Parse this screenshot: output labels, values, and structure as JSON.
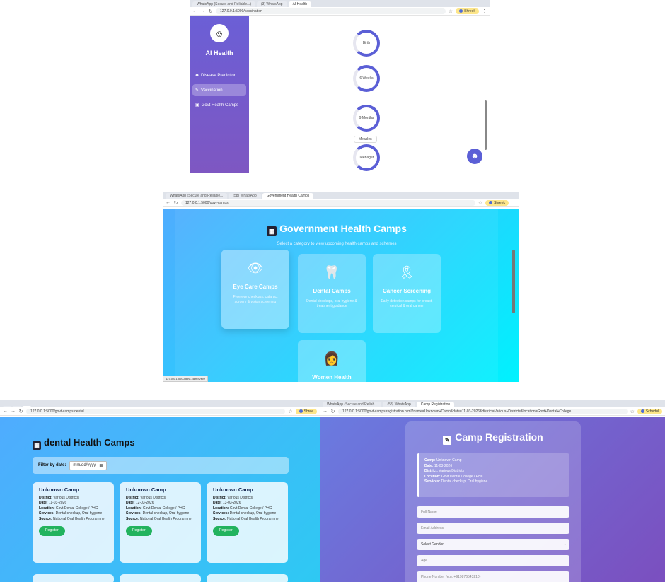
{
  "panel1": {
    "tabs": [
      "WhatsApp (Secure and Reliable...)",
      "(3) WhatsApp",
      "AI Health"
    ],
    "url": "127.0.0.1:5000/vaccination",
    "profile": "Shreek",
    "sidebar": {
      "title": "AI Health",
      "items": [
        {
          "label": "Disease Prediction",
          "icon": "virus-icon"
        },
        {
          "label": "Vaccination",
          "icon": "syringe-icon",
          "active": true
        },
        {
          "label": "Govt Health Camps",
          "icon": "building-icon"
        }
      ]
    },
    "timeline": [
      "Birth",
      "6 Weeks",
      "9 Months",
      "Teenager"
    ],
    "tooltip": "Measles"
  },
  "panel2": {
    "tabs": [
      "WhatsApp (Secure and Reliable...",
      "(58) WhatsApp",
      "Government Health Camps"
    ],
    "url": "127.0.0.1:5000/govt-camps",
    "profile": "Shreek",
    "title": "Government Health Camps",
    "subtitle": "Select a category to view upcoming health camps and schemes",
    "cards": [
      {
        "title": "Eye Care Camps",
        "desc": "Free eye checkups, cataract surgery & vision screening",
        "icon": "eye-icon"
      },
      {
        "title": "Dental Camps",
        "desc": "Dental checkups, oral hygiene & treatment guidance",
        "icon": "tooth-icon"
      },
      {
        "title": "Cancer Screening",
        "desc": "Early detection camps for breast, cervical & oral cancer",
        "icon": "ribbon-icon"
      },
      {
        "title": "Women Health",
        "desc": "",
        "icon": "woman-doctor-icon"
      }
    ],
    "status_url": "127.0.0.1:5000/govt-camps/eye"
  },
  "panel3": {
    "url": "127.0.0.1:5000/govt-camps/dental",
    "profile": "Shree",
    "title": "dental Health Camps",
    "filter_label": "Filter by date:",
    "date_placeholder": "mm/dd/yyyy",
    "camps": [
      {
        "name": "Unknown Camp",
        "district": "Various Districts",
        "date": "11-03-2026",
        "location": "Govt Dental College / PHC",
        "services": "Dental checkup, Oral hygiene",
        "source": "National Oral Health Programme",
        "button": "Register"
      },
      {
        "name": "Unknown Camp",
        "district": "Various Districts",
        "date": "12-03-2026",
        "location": "Govt Dental College / PHC",
        "services": "Dental checkup, Oral hygiene",
        "source": "National Oral Health Programme",
        "button": "Register"
      },
      {
        "name": "Unknown Camp",
        "district": "Various Districts",
        "date": "13-03-2026",
        "location": "Govt Dental College / PHC",
        "services": "Dental checkup, Oral hygiene",
        "source": "National Oral Health Programme",
        "button": "Register"
      }
    ],
    "labels": {
      "district": "District:",
      "date": "Date:",
      "location": "Location:",
      "services": "Services:",
      "source": "Source:"
    }
  },
  "panel4": {
    "tabs": [
      "WhatsApp (Secure and Reliab...",
      "(58) WhatsApp",
      "Camp Registration"
    ],
    "url": "127.0.0.1:5000/govt-camps/registration.html?name=Unknown+Camp&date=11-03-2026&district=Various+Districts&location=Govt+Dental+College...",
    "profile": "Schedul",
    "title": "Camp Registration",
    "info": {
      "camp_label": "Camp:",
      "camp": "Unknown Camp",
      "date_label": "Date:",
      "date": "11-03-2026",
      "district_label": "District:",
      "district": "Various Districts",
      "location_label": "Location:",
      "location": "Govt Dental College / PHC",
      "services_label": "Services:",
      "services": "Dental checkup, Oral hygiene"
    },
    "fields": {
      "full_name": "Full Name",
      "email": "Email Address",
      "gender": "Select Gender",
      "age": "Age",
      "phone": "Phone Number (e.g. +919876543210)"
    }
  }
}
